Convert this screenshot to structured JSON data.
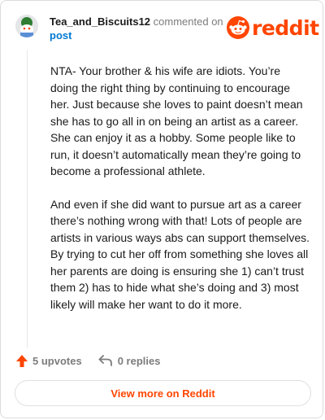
{
  "header": {
    "username": "Tea_and_Biscuits12",
    "commented_text": "commented on",
    "post_link": "post",
    "brand": "reddit"
  },
  "comment": {
    "paragraphs": [
      "NTA- Your brother & his wife are idiots. You’re doing the right thing by continuing to encourage her. Just because she loves to paint doesn’t mean she has to go all in on being an artist as a career. She can enjoy it as a hobby. Some people like to run, it doesn’t automatically mean they’re going to become a professional athlete.",
      "And even if she did want to pursue art as a career there’s nothing wrong with that! Lots of people are artists in various ways abs can support themselves. By trying to cut her off from something she loves all her parents are doing is ensuring she 1) can’t trust them 2) has to hide what she’s doing and 3) most likely will make her want to do it more."
    ]
  },
  "actions": {
    "upvotes": "5 upvotes",
    "replies": "0 replies"
  },
  "footer": {
    "view_more": "View more on Reddit"
  },
  "colors": {
    "brand": "#ff4500",
    "link": "#0079d3",
    "muted": "#7c7c7c"
  },
  "icons": {
    "avatar": "snoo-avatar",
    "logo": "reddit-snoo-icon",
    "upvote": "upvote-arrow-icon",
    "reply": "reply-arrow-icon"
  }
}
